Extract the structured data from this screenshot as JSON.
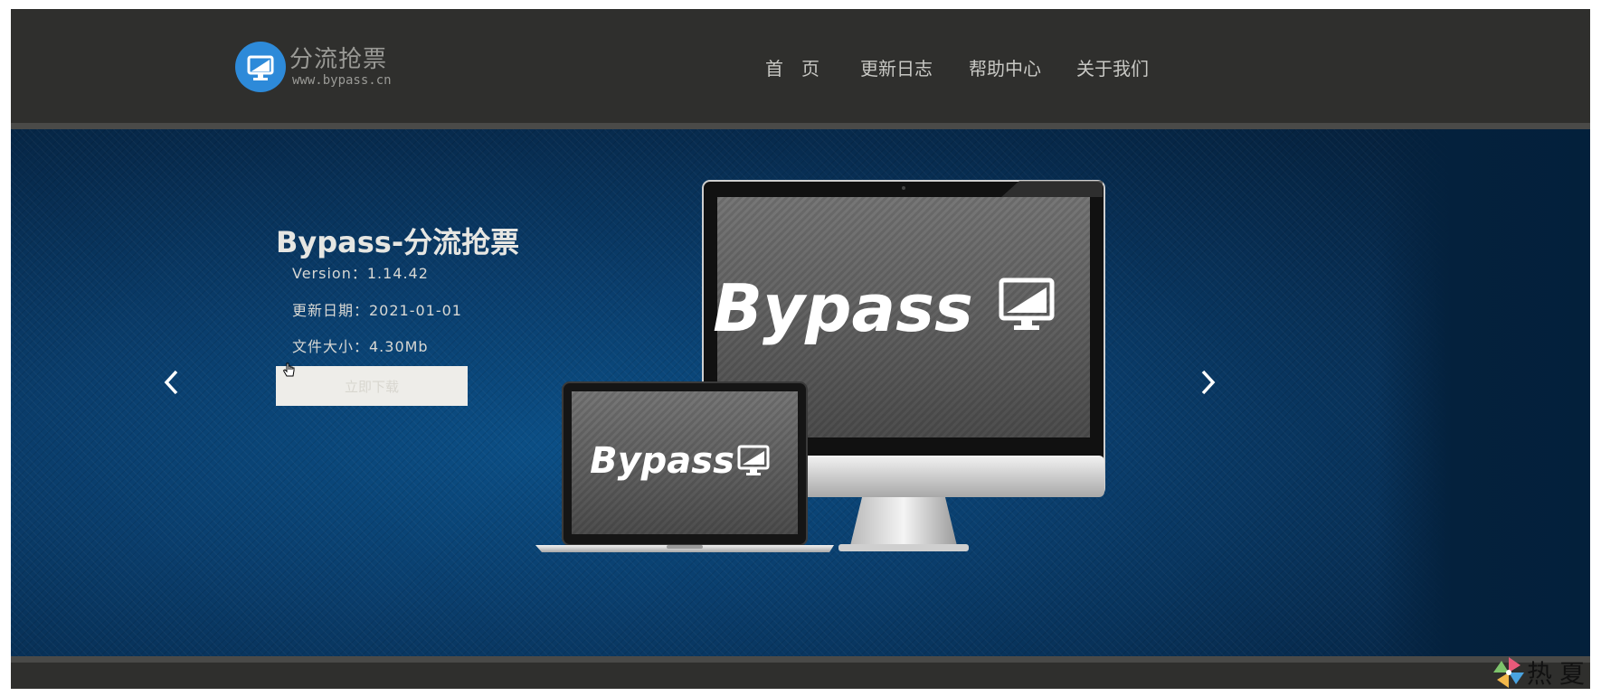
{
  "header": {
    "logo_title": "分流抢票",
    "logo_domain": "www.bypass.cn",
    "nav": [
      {
        "label": "首　页"
      },
      {
        "label": "更新日志"
      },
      {
        "label": "帮助中心"
      },
      {
        "label": "关于我们"
      }
    ]
  },
  "hero": {
    "title": "Bypass-分流抢票",
    "version": "Version：1.14.42",
    "update_date": "更新日期：2021-01-01",
    "file_size": "文件大小：4.30Mb",
    "download_label": "立即下载",
    "screen_brand": "Bypass"
  },
  "corner": {
    "text": "热夏"
  },
  "colors": {
    "header_bg": "#2f2f2d",
    "banner_blue": "#0b4f86",
    "logo_blue": "#2d8ad9"
  },
  "icons": [
    "monitor-logo-icon",
    "chevron-left-icon",
    "chevron-right-icon",
    "cursor-hand-icon",
    "pinwheel-icon"
  ]
}
